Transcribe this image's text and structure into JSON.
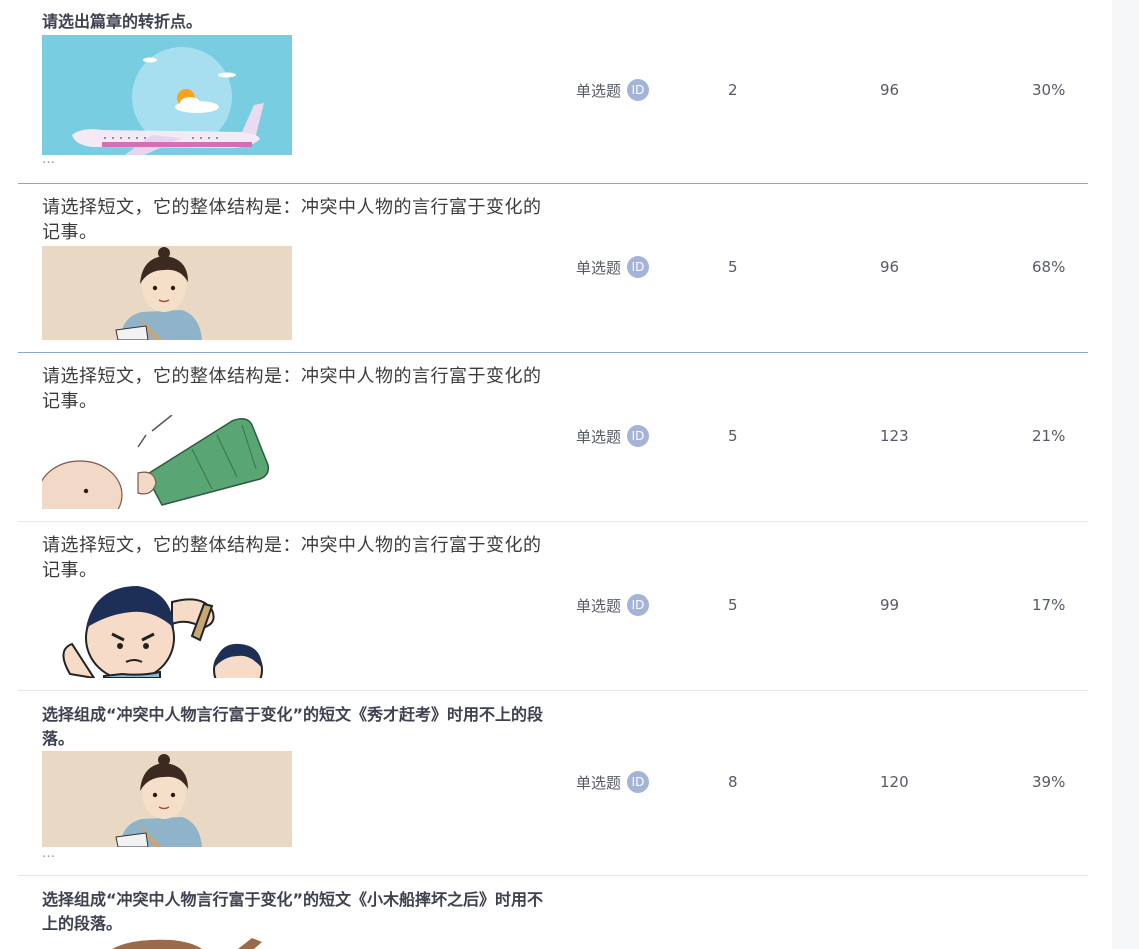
{
  "questions": [
    {
      "text": "请选出篇章的转折点。",
      "image": "airplane-sky-illustration",
      "ellipsis": "…",
      "type": "单选题",
      "id_badge": "ID",
      "score": "2",
      "count": "96",
      "rate": "30%"
    },
    {
      "text": "请选择短文，它的整体结构是：冲突中人物的言行富于变化的记事。",
      "image": "scholar-reading-cartoon",
      "type": "单选题",
      "id_badge": "ID",
      "score": "5",
      "count": "96",
      "rate": "68%"
    },
    {
      "text": "请选择短文，它的整体结构是：冲突中人物的言行富于变化的记事。",
      "image": "baby-drinking-bottle-cartoon",
      "type": "单选题",
      "id_badge": "ID",
      "score": "5",
      "count": "123",
      "rate": "21%"
    },
    {
      "text": "请选择短文，它的整体结构是：冲突中人物的言行富于变化的记事。",
      "image": "angry-kids-cartoon",
      "type": "单选题",
      "id_badge": "ID",
      "score": "5",
      "count": "99",
      "rate": "17%"
    },
    {
      "text": "选择组成“冲突中人物言行富于变化”的短文《秀才赶考》时用不上的段落。",
      "image": "scholar-reading-cartoon",
      "ellipsis": "…",
      "type": "单选题",
      "id_badge": "ID",
      "score": "8",
      "count": "120",
      "rate": "39%"
    },
    {
      "text": "选择组成“冲突中人物言行富于变化”的短文《小木船摔坏之后》时用不上的段落。",
      "image": "cartoon-partial"
    }
  ]
}
